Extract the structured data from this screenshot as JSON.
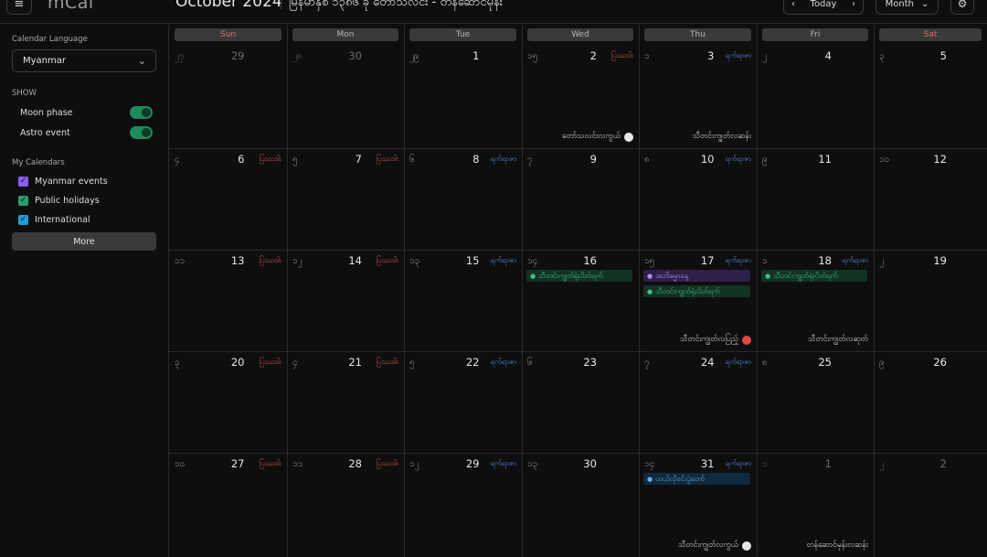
{
  "header": {
    "menu_icon": "≡",
    "logo": "mCal",
    "month_title": "October 2024",
    "myanmar_title": "မြန်မာနှစ် ၁၃၈၆ ခု တော်သလင်း - တန်ဆောင်မုန်း",
    "prev_icon": "‹",
    "today_label": "Today",
    "next_icon": "›",
    "view_label": "Month",
    "view_chevron": "⌄",
    "settings_icon": "⚙"
  },
  "sidebar": {
    "language_label": "Calendar Language",
    "language_value": "Myanmar",
    "language_chevron": "⌄",
    "show_label": "SHOW",
    "toggles": [
      {
        "label": "Moon phase",
        "on": true
      },
      {
        "label": "Astro event",
        "on": true
      }
    ],
    "my_calendars_label": "My Calendars",
    "calendars": [
      {
        "label": "Myanmar events",
        "color": "#8b5cf6",
        "check": "✓"
      },
      {
        "label": "Public holidays",
        "color": "#22a06b",
        "check": "✓"
      },
      {
        "label": "International",
        "color": "#1e9bd7",
        "check": "✓"
      }
    ],
    "more_label": "More"
  },
  "weekdays": [
    "Sun",
    "Mon",
    "Tue",
    "Wed",
    "Thu",
    "Fri",
    "Sat"
  ],
  "colors": {
    "weekend_header": "#e36c6c",
    "pyathada": "#d45a5a",
    "yatyaza": "#5b8ee6"
  },
  "weeks": [
    [
      {
        "mm": "၂၇",
        "day": "29",
        "dim": true
      },
      {
        "mm": "၂၈",
        "day": "30",
        "dim": true
      },
      {
        "mm": "၂၉",
        "day": "1"
      },
      {
        "mm": "၁၅",
        "day": "2",
        "badge": "ပြဿဒါး",
        "badge_type": "red",
        "astro": "တော်သလင်းလကွယ်",
        "moon": "white"
      },
      {
        "mm": "၁",
        "day": "3",
        "badge": "ရက်ရာဇာ",
        "badge_type": "blue",
        "astro": "သီတင်းကျွတ်လဆန်း"
      },
      {
        "mm": "၂",
        "day": "4"
      },
      {
        "mm": "၃",
        "day": "5"
      }
    ],
    [
      {
        "mm": "၄",
        "day": "6",
        "badge": "ပြဿဒါး",
        "badge_type": "red"
      },
      {
        "mm": "၅",
        "day": "7",
        "badge": "ပြဿဒါး",
        "badge_type": "red"
      },
      {
        "mm": "၆",
        "day": "8",
        "badge": "ရက်ရာဇာ",
        "badge_type": "blue"
      },
      {
        "mm": "၇",
        "day": "9"
      },
      {
        "mm": "၈",
        "day": "10",
        "badge": "ရက်ရာဇာ",
        "badge_type": "blue"
      },
      {
        "mm": "၉",
        "day": "11"
      },
      {
        "mm": "၁၀",
        "day": "12"
      }
    ],
    [
      {
        "mm": "၁၁",
        "day": "13",
        "badge": "ပြဿဒါး",
        "badge_type": "red"
      },
      {
        "mm": "၁၂",
        "day": "14",
        "badge": "ပြဿဒါး",
        "badge_type": "red"
      },
      {
        "mm": "၁၃",
        "day": "15",
        "badge": "ရက်ရာဇာ",
        "badge_type": "blue"
      },
      {
        "mm": "၁၄",
        "day": "16",
        "events": [
          {
            "text": "သီတင်းကျွတ်ရုံးပိတ်ရက်",
            "type": "green"
          }
        ]
      },
      {
        "mm": "၁၅",
        "day": "17",
        "badge": "ရက်ရာဇာ",
        "badge_type": "blue",
        "events": [
          {
            "text": "အဘိဓမ္မာနေ့",
            "type": "purple"
          },
          {
            "text": "သီတင်းကျွတ်ရုံးပိတ်ရက်",
            "type": "green"
          }
        ],
        "astro": "သီတင်းကျွတ်လပြည့်",
        "moon": "red"
      },
      {
        "mm": "၁",
        "day": "18",
        "badge": "ရက်ရာဇာ",
        "badge_type": "blue",
        "events": [
          {
            "text": "သီတင်းကျွတ်ရုံးပိတ်ရက်",
            "type": "green"
          }
        ],
        "astro": "သီတင်းကျွတ်လဆုတ်"
      },
      {
        "mm": "၂",
        "day": "19"
      }
    ],
    [
      {
        "mm": "၃",
        "day": "20",
        "badge": "ပြဿဒါး",
        "badge_type": "red"
      },
      {
        "mm": "၄",
        "day": "21",
        "badge": "ပြဿဒါး",
        "badge_type": "red"
      },
      {
        "mm": "၅",
        "day": "22",
        "badge": "ရက်ရာဇာ",
        "badge_type": "blue"
      },
      {
        "mm": "၆",
        "day": "23"
      },
      {
        "mm": "၇",
        "day": "24",
        "badge": "ရက်ရာဇာ",
        "badge_type": "blue"
      },
      {
        "mm": "၈",
        "day": "25"
      },
      {
        "mm": "၉",
        "day": "26"
      }
    ],
    [
      {
        "mm": "၁၀",
        "day": "27",
        "badge": "ပြဿဒါး",
        "badge_type": "red"
      },
      {
        "mm": "၁၁",
        "day": "28",
        "badge": "ပြဿဒါး",
        "badge_type": "red"
      },
      {
        "mm": "၁၂",
        "day": "29",
        "badge": "ရက်ရာဇာ",
        "badge_type": "blue"
      },
      {
        "mm": "၁၃",
        "day": "30"
      },
      {
        "mm": "၁၄",
        "day": "31",
        "badge": "ရက်ရာဇာ",
        "badge_type": "blue",
        "events": [
          {
            "text": "ဟယ်လိုဝင်းပွဲတော်",
            "type": "blue"
          }
        ],
        "astro": "သီတင်းကျွတ်လကွယ်",
        "moon": "white"
      },
      {
        "mm": "၁",
        "day": "1",
        "dim": true,
        "astro": "တန်ဆောင်မုန်းလဆန်း"
      },
      {
        "mm": "၂",
        "day": "2",
        "dim": true
      }
    ]
  ]
}
